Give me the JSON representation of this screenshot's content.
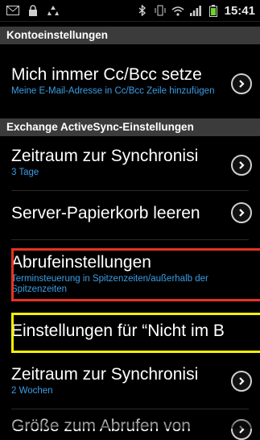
{
  "status_bar": {
    "time": "15:41",
    "icons_left": [
      "email-icon",
      "lock-icon",
      "recycle-icon"
    ],
    "icons_right": [
      "bluetooth-icon",
      "vibrate-icon",
      "wifi-icon",
      "signal-icon",
      "battery-icon"
    ]
  },
  "sections": {
    "account": {
      "header": "Kontoeinstellungen"
    },
    "exchange": {
      "header": "Exchange ActiveSync-Einstellungen"
    }
  },
  "items": [
    {
      "title": "Mich immer Cc/Bcc setze",
      "subtitle": "Meine E-Mail-Adresse in Cc/Bcc Zeile hinzufügen"
    },
    {
      "title": "Zeitraum zur Synchronisi",
      "subtitle": "3 Tage"
    },
    {
      "title": "Server-Papierkorb leeren",
      "subtitle": ""
    },
    {
      "title": "Abrufeinstellungen",
      "subtitle": "Terminsteuerung in Spitzenzeiten/außerhalb der Spitzenzeiten"
    },
    {
      "title": "Einstellungen für “Nicht im Bü",
      "subtitle": ""
    },
    {
      "title": "Zeitraum zur Synchronisi",
      "subtitle": "2 Wochen"
    },
    {
      "title": "Größe zum Abrufen von",
      "subtitle": ""
    }
  ],
  "highlights": {
    "red": "#e8321f",
    "yellow": "#f5f000"
  }
}
